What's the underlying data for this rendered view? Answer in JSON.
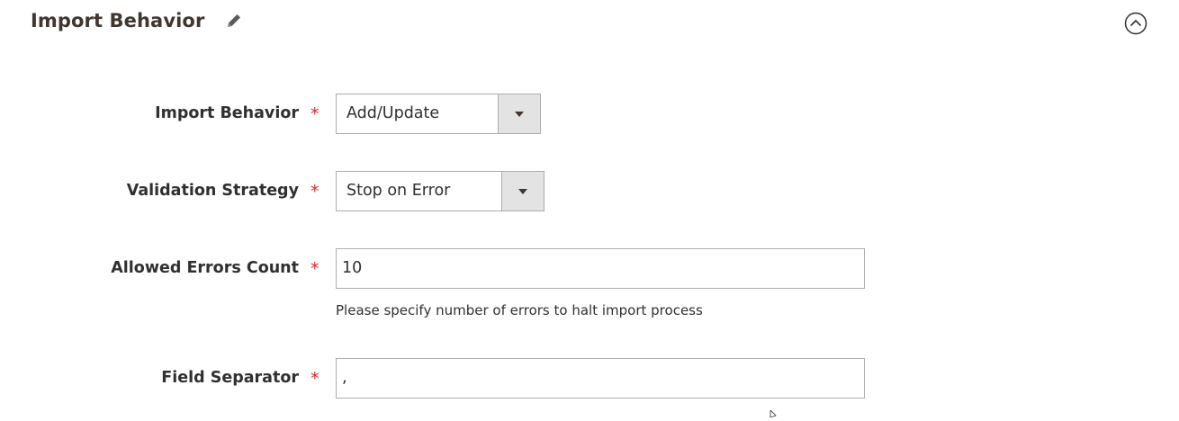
{
  "section": {
    "title": "Import Behavior",
    "edit_icon": "pencil-icon",
    "collapse_icon": "chevron-up-circle-icon"
  },
  "fields": {
    "import_behavior": {
      "label": "Import Behavior",
      "required_mark": "*",
      "value": "Add/Update",
      "arrow_icon": "caret-down-icon"
    },
    "validation_strategy": {
      "label": "Validation Strategy",
      "required_mark": "*",
      "value": "Stop on Error",
      "arrow_icon": "caret-down-icon"
    },
    "allowed_errors_count": {
      "label": "Allowed Errors Count",
      "required_mark": "*",
      "value": "10",
      "note": "Please specify number of errors to halt import process"
    },
    "field_separator": {
      "label": "Field Separator",
      "required_mark": "*",
      "value": ","
    }
  },
  "colors": {
    "required": "#e22626",
    "text": "#303030",
    "border": "#adadad",
    "select_button_bg": "#e3e3e3"
  }
}
